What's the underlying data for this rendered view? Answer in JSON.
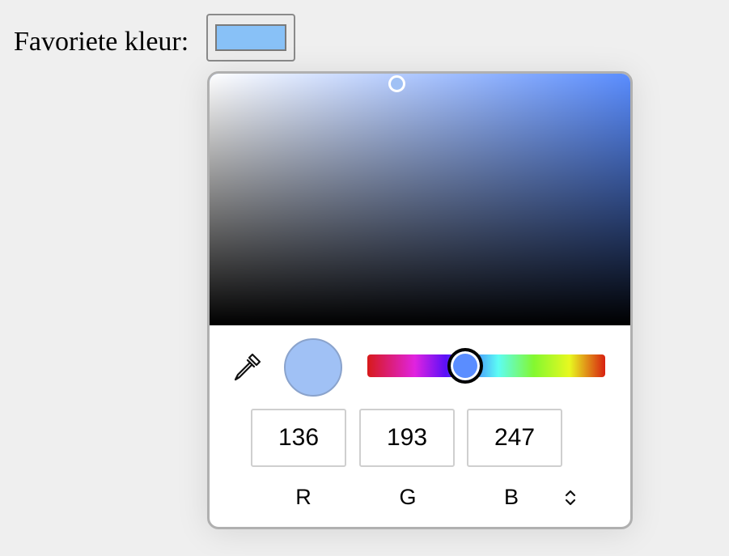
{
  "field": {
    "label": "Favoriete kleur:",
    "color": "#88c1f7"
  },
  "picker": {
    "hue_color": "#5a8dff",
    "selected_color": "#a0c1f5",
    "hue_value": 216,
    "saturation": 0.45,
    "brightness": 0.97,
    "rgb": {
      "r_value": "136",
      "g_value": "193",
      "b_value": "247",
      "r_label": "R",
      "g_label": "G",
      "b_label": "B"
    },
    "icons": {
      "eyedropper": "eyedropper-icon",
      "mode_toggle": "chevron-up-down-icon"
    }
  }
}
